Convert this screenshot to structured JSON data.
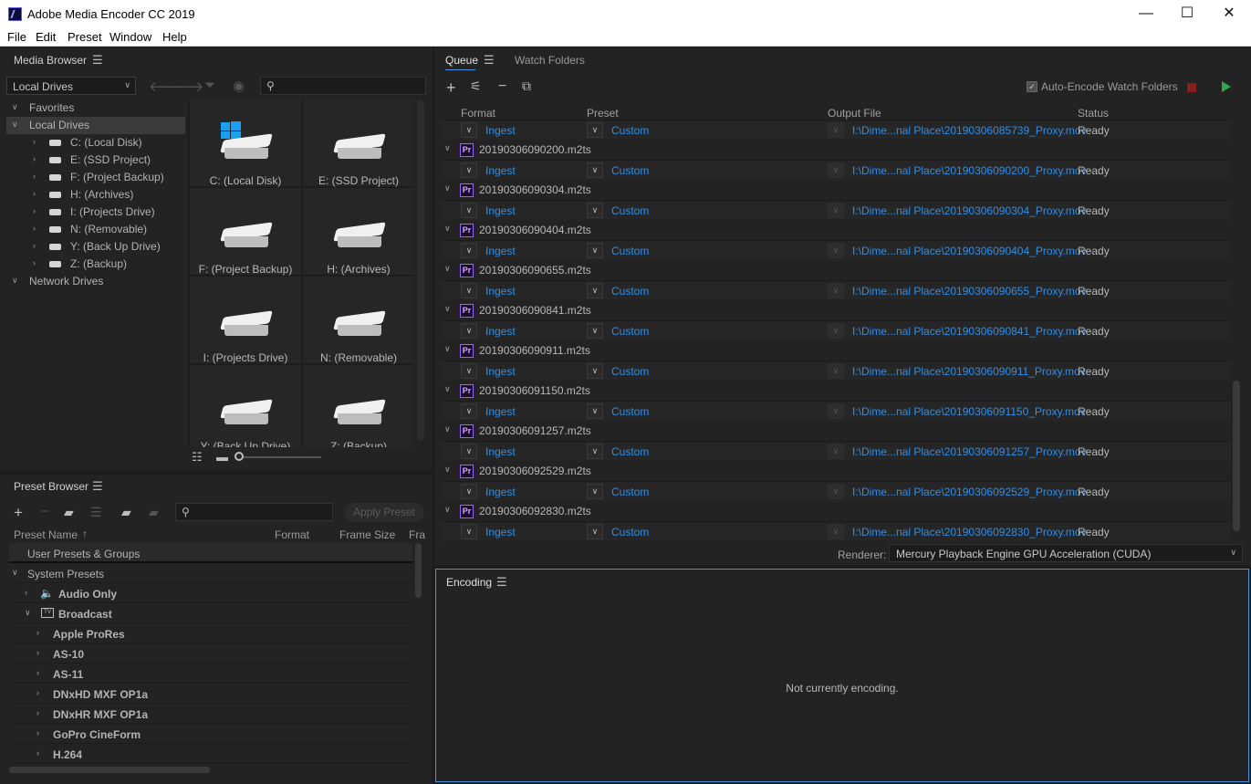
{
  "app": {
    "title": "Adobe Media Encoder CC 2019"
  },
  "window_controls": {
    "minimize": "—",
    "maximize": "☐",
    "close": "✕"
  },
  "menu": [
    "File",
    "Edit",
    "Preset",
    "Window",
    "Help"
  ],
  "media_browser": {
    "title": "Media Browser",
    "location_select": "Local Drives",
    "tree": {
      "favorites": "Favorites",
      "local_drives": "Local Drives",
      "drives": [
        "C: (Local Disk)",
        "E: (SSD Project)",
        "F: (Project Backup)",
        "H: (Archives)",
        "I: (Projects Drive)",
        "N: (Removable)",
        "Y: (Back Up Drive)",
        "Z: (Backup)"
      ],
      "network_drives": "Network Drives"
    },
    "grid": [
      "C: (Local Disk)",
      "E: (SSD Project)",
      "F: (Project Backup)",
      "H: (Archives)",
      "I: (Projects Drive)",
      "N: (Removable)",
      "Y: (Back Up Drive)",
      "Z: (Backup)"
    ]
  },
  "preset_browser": {
    "title": "Preset Browser",
    "apply_button": "Apply Preset",
    "columns": [
      "Preset Name",
      "Format",
      "Frame Size",
      "Fra"
    ],
    "rows": [
      {
        "label": "User Presets & Groups",
        "level": 0,
        "arrow": ""
      },
      {
        "label": "System Presets",
        "level": 0,
        "arrow": "∨"
      },
      {
        "label": "Audio Only",
        "level": 1,
        "arrow": "›"
      },
      {
        "label": "Broadcast",
        "level": 1,
        "arrow": "∨"
      },
      {
        "label": "Apple ProRes",
        "level": 2,
        "arrow": "›"
      },
      {
        "label": "AS-10",
        "level": 2,
        "arrow": "›"
      },
      {
        "label": "AS-11",
        "level": 2,
        "arrow": "›"
      },
      {
        "label": "DNxHD MXF OP1a",
        "level": 2,
        "arrow": "›"
      },
      {
        "label": "DNxHR MXF OP1a",
        "level": 2,
        "arrow": "›"
      },
      {
        "label": "GoPro CineForm",
        "level": 2,
        "arrow": "›"
      },
      {
        "label": "H.264",
        "level": 2,
        "arrow": "›"
      }
    ]
  },
  "queue": {
    "tabs": [
      "Queue",
      "Watch Folders"
    ],
    "auto_encode_label": "Auto-Encode Watch Folders",
    "columns": [
      "Format",
      "Preset",
      "Output File",
      "Status"
    ],
    "first_job": {
      "format": "Ingest",
      "preset": "Custom",
      "output": "I:\\Dime...nal Place\\20190306085739_Proxy.mov",
      "status": "Ready"
    },
    "items": [
      {
        "source": "20190306090200.m2ts",
        "format": "Ingest",
        "preset": "Custom",
        "output": "I:\\Dime...nal Place\\20190306090200_Proxy.mov",
        "status": "Ready"
      },
      {
        "source": "20190306090304.m2ts",
        "format": "Ingest",
        "preset": "Custom",
        "output": "I:\\Dime...nal Place\\20190306090304_Proxy.mov",
        "status": "Ready"
      },
      {
        "source": "20190306090404.m2ts",
        "format": "Ingest",
        "preset": "Custom",
        "output": "I:\\Dime...nal Place\\20190306090404_Proxy.mov",
        "status": "Ready"
      },
      {
        "source": "20190306090655.m2ts",
        "format": "Ingest",
        "preset": "Custom",
        "output": "I:\\Dime...nal Place\\20190306090655_Proxy.mov",
        "status": "Ready"
      },
      {
        "source": "20190306090841.m2ts",
        "format": "Ingest",
        "preset": "Custom",
        "output": "I:\\Dime...nal Place\\20190306090841_Proxy.mov",
        "status": "Ready"
      },
      {
        "source": "20190306090911.m2ts",
        "format": "Ingest",
        "preset": "Custom",
        "output": "I:\\Dime...nal Place\\20190306090911_Proxy.mov",
        "status": "Ready"
      },
      {
        "source": "20190306091150.m2ts",
        "format": "Ingest",
        "preset": "Custom",
        "output": "I:\\Dime...nal Place\\20190306091150_Proxy.mov",
        "status": "Ready"
      },
      {
        "source": "20190306091257.m2ts",
        "format": "Ingest",
        "preset": "Custom",
        "output": "I:\\Dime...nal Place\\20190306091257_Proxy.mov",
        "status": "Ready"
      },
      {
        "source": "20190306092529.m2ts",
        "format": "Ingest",
        "preset": "Custom",
        "output": "I:\\Dime...nal Place\\20190306092529_Proxy.mov",
        "status": "Ready"
      },
      {
        "source": "20190306092830.m2ts",
        "format": "Ingest",
        "preset": "Custom",
        "output": "I:\\Dime...nal Place\\20190306092830_Proxy.mov",
        "status": "Ready"
      }
    ],
    "renderer_label": "Renderer:",
    "renderer_value": "Mercury Playback Engine GPU Acceleration (CUDA)"
  },
  "encoding": {
    "title": "Encoding",
    "message": "Not currently encoding."
  },
  "colors": {
    "accent": "#2f8ee9",
    "play": "#2ea84c",
    "stop": "#8a1f1f",
    "premiere": "#9a64ff"
  }
}
